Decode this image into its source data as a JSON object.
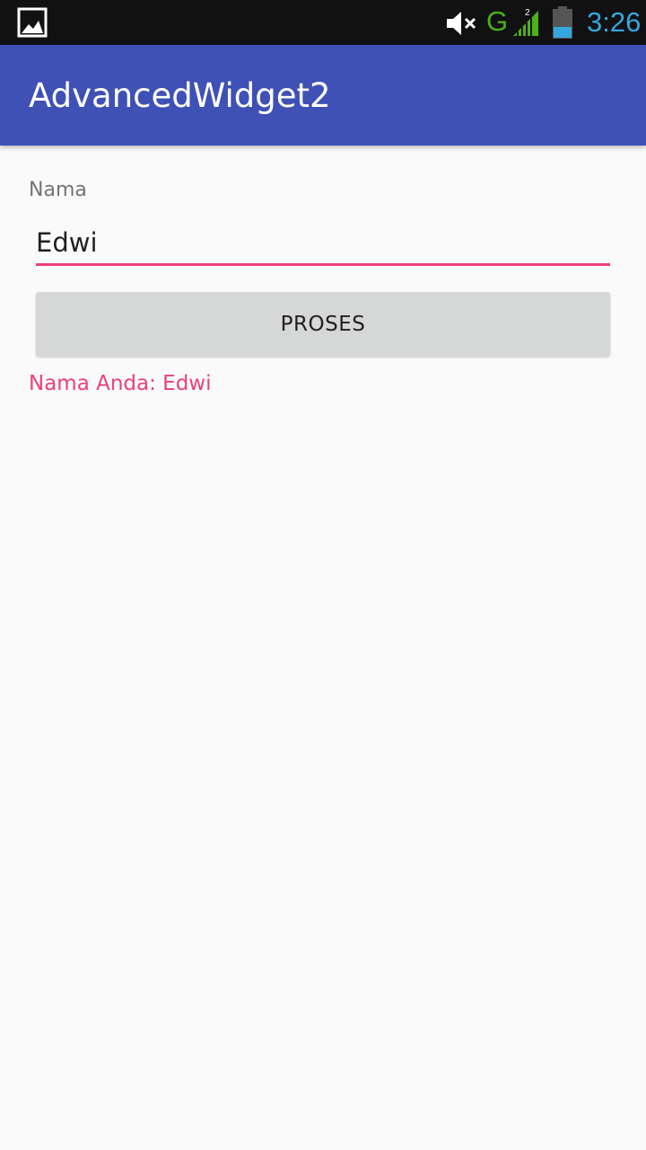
{
  "status_bar": {
    "notification_icon": "gallery-icon",
    "volume_icon": "mute-icon",
    "network_type": "G",
    "signal_badge": "2",
    "signal_icon": "signal-icon",
    "battery_icon": "battery-icon",
    "time": "3:26",
    "colors": {
      "background": "#111111",
      "network": "#4caf1c",
      "time": "#35a7e0"
    }
  },
  "toolbar": {
    "title": "AdvancedWidget2",
    "color": "#3f51b5"
  },
  "form": {
    "name_label": "Nama",
    "name_value": "Edwi",
    "accent_color": "#ec407a",
    "button_label": "PROSES",
    "result": "Nama Anda: Edwi"
  }
}
